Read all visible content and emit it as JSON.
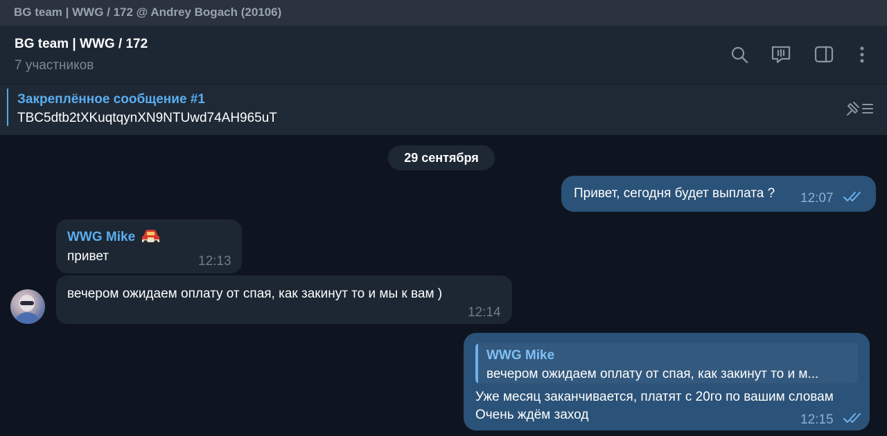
{
  "window": {
    "title": "BG team | WWG / 172 @ Andrey Bogach (20106)"
  },
  "header": {
    "chat_name": "BG team | WWG / 172",
    "members": "7 участников",
    "icons": [
      "search-icon",
      "video-chat-icon",
      "sidebar-toggle-icon",
      "more-vertical-icon"
    ]
  },
  "pinned": {
    "title": "Закреплённое сообщение #1",
    "text": "TBC5dtb2tXKuqtqynXN9NTUwd74AH965uT",
    "icon": "pinned-list-icon"
  },
  "date_separator": "29 сентября",
  "colors": {
    "background": "#0f1520",
    "outgoing_bubble": "#2b5278",
    "incoming_bubble": "#1c2733",
    "accent": "#5aaef0"
  },
  "messages": [
    {
      "direction": "out",
      "text": "Привет, сегодня будет выплата ?",
      "time": "12:07",
      "status": "read"
    },
    {
      "direction": "in",
      "sender": "WWG Mike",
      "sender_emoji": "car-emoji",
      "text": "привет",
      "time": "12:13"
    },
    {
      "direction": "in",
      "text": "вечером ожидаем оплату от спая, как закинут то и мы к вам )",
      "time": "12:14",
      "avatar": "user-avatar"
    },
    {
      "direction": "out",
      "reply_to": {
        "sender": "WWG Mike",
        "text": "вечером ожидаем оплату от спая, как закинут то и м..."
      },
      "lines": [
        "Уже месяц заканчивается, платят с 20го по вашим словам",
        "Очень ждём заход"
      ],
      "time": "12:15",
      "status": "read"
    }
  ]
}
